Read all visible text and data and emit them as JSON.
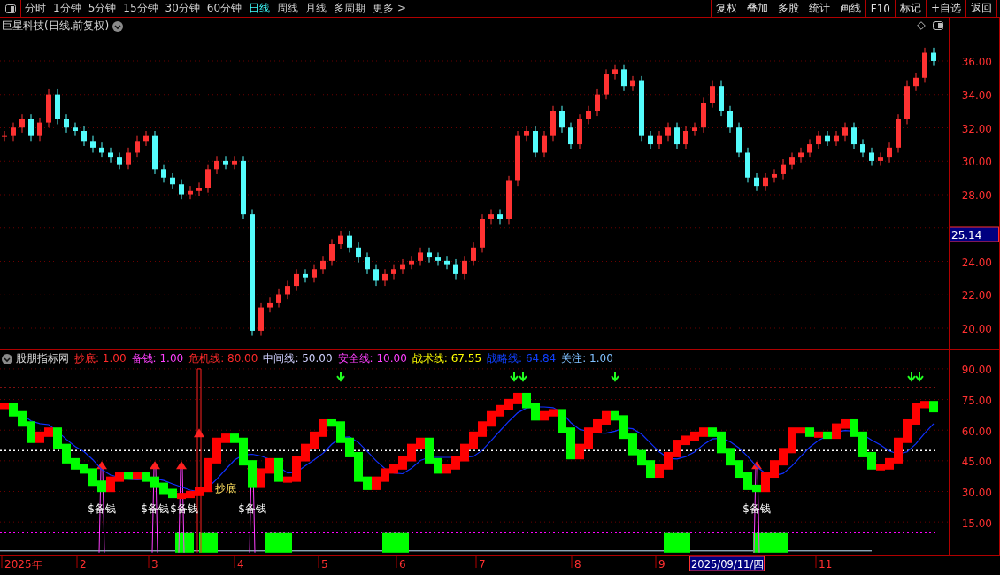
{
  "toolbar": {
    "tabs": [
      {
        "label": "分时",
        "selected": false
      },
      {
        "label": "1分钟",
        "selected": false
      },
      {
        "label": "5分钟",
        "selected": false
      },
      {
        "label": "15分钟",
        "selected": false
      },
      {
        "label": "30分钟",
        "selected": false
      },
      {
        "label": "60分钟",
        "selected": false
      },
      {
        "label": "日线",
        "selected": true
      },
      {
        "label": "周线",
        "selected": false
      },
      {
        "label": "月线",
        "selected": false
      },
      {
        "label": "多周期",
        "selected": false
      },
      {
        "label": "更多 >",
        "selected": false
      }
    ],
    "buttons": [
      "复权",
      "叠加",
      "多股",
      "统计",
      "画线",
      "F10",
      "标记",
      "+自选",
      "返回"
    ]
  },
  "price_panel": {
    "title": "巨星科技(日线.前复权)",
    "axis_labels": [
      "36.00",
      "34.00",
      "32.00",
      "30.00",
      "28.00",
      "24.00",
      "22.00",
      "20.00"
    ],
    "cursor_price": "25.14"
  },
  "indicator_panel": {
    "title": "股朋指标网",
    "legend": [
      {
        "label": "抄底: 1.00",
        "color": "#ff2a2a"
      },
      {
        "label": "备钱: 1.00",
        "color": "#ff40ff"
      },
      {
        "label": "危机线: 80.00",
        "color": "#ff2a2a"
      },
      {
        "label": "中间线: 50.00",
        "color": "#d0d0ff"
      },
      {
        "label": "安全线: 10.00",
        "color": "#ff40ff"
      },
      {
        "label": "战术线: 67.55",
        "color": "#ffff00"
      },
      {
        "label": "战略线: 64.84",
        "color": "#1040ff"
      },
      {
        "label": "关注: 1.00",
        "color": "#80c0ff"
      }
    ],
    "signal_labels": [
      {
        "text": "$备钱",
        "kind": "buy"
      },
      {
        "text": "$备钱",
        "kind": "buy"
      },
      {
        "text": "$备钱",
        "kind": "buy"
      },
      {
        "text": "抄底",
        "kind": "bottom"
      },
      {
        "text": "$备钱",
        "kind": "buy"
      },
      {
        "text": "$备钱",
        "kind": "buy"
      }
    ],
    "axis_labels": [
      "90.00",
      "75.00",
      "60.00",
      "45.00",
      "30.00",
      "15.00"
    ]
  },
  "date_axis": [
    {
      "label": "2025年",
      "selected": false
    },
    {
      "label": "2",
      "selected": false
    },
    {
      "label": "3",
      "selected": false
    },
    {
      "label": "4",
      "selected": false
    },
    {
      "label": "5",
      "selected": false
    },
    {
      "label": "6",
      "selected": false
    },
    {
      "label": "7",
      "selected": false
    },
    {
      "label": "8",
      "selected": false
    },
    {
      "label": "9",
      "selected": false
    },
    {
      "label": "2025/09/11/四",
      "selected": true
    },
    {
      "label": "11",
      "selected": false
    }
  ]
}
